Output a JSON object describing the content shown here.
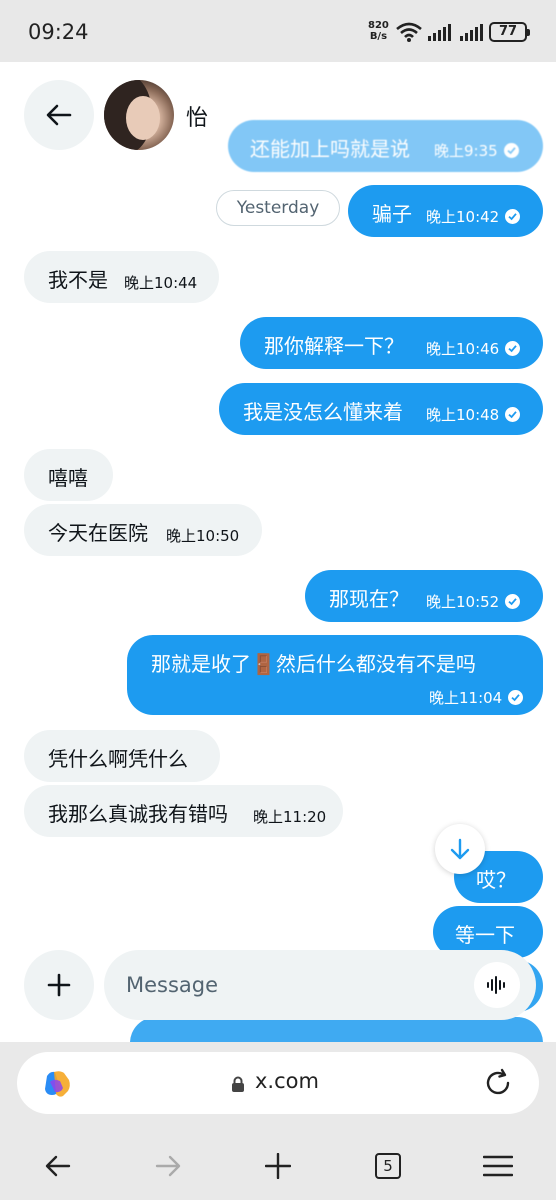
{
  "status_bar": {
    "time": "09:24",
    "net_speed_value": "820",
    "net_speed_unit": "B/s",
    "battery": "77"
  },
  "header": {
    "contact_name": "怡"
  },
  "day_divider": "Yesterday",
  "messages": [
    {
      "dir": "out",
      "text": "还能加上吗就是说",
      "time": "晚上9:35",
      "faded": true
    },
    {
      "dir": "out",
      "text": "骗子",
      "time": "晚上10:42"
    },
    {
      "dir": "in",
      "text": "我不是",
      "time": "晚上10:44"
    },
    {
      "dir": "out",
      "text": "那你解释一下？",
      "time": "晚上10:46"
    },
    {
      "dir": "out",
      "text": "我是没怎么懂来着",
      "time": "晚上10:48"
    },
    {
      "dir": "in",
      "text": "嘻嘻",
      "time": ""
    },
    {
      "dir": "in",
      "text": "今天在医院",
      "time": "晚上10:50"
    },
    {
      "dir": "out",
      "text": "那现在？",
      "time": "晚上10:52"
    },
    {
      "dir": "out",
      "text": "那就是收了🚪然后什么都没有不是吗",
      "time": "晚上11:04"
    },
    {
      "dir": "in",
      "text": "凭什么啊凭什么",
      "time": ""
    },
    {
      "dir": "in",
      "text": "我那么真诚我有错吗",
      "time": "晚上11:20"
    },
    {
      "dir": "out",
      "text": "哎？",
      "time": ""
    },
    {
      "dir": "out",
      "text": "等一下",
      "time": ""
    }
  ],
  "composer": {
    "placeholder": "Message"
  },
  "browser": {
    "url": "x.com",
    "tab_count": "5"
  },
  "colors": {
    "outgoing_bubble": "#1d9bf0",
    "incoming_bubble": "#eff3f4",
    "accent": "#1d9bf0"
  }
}
